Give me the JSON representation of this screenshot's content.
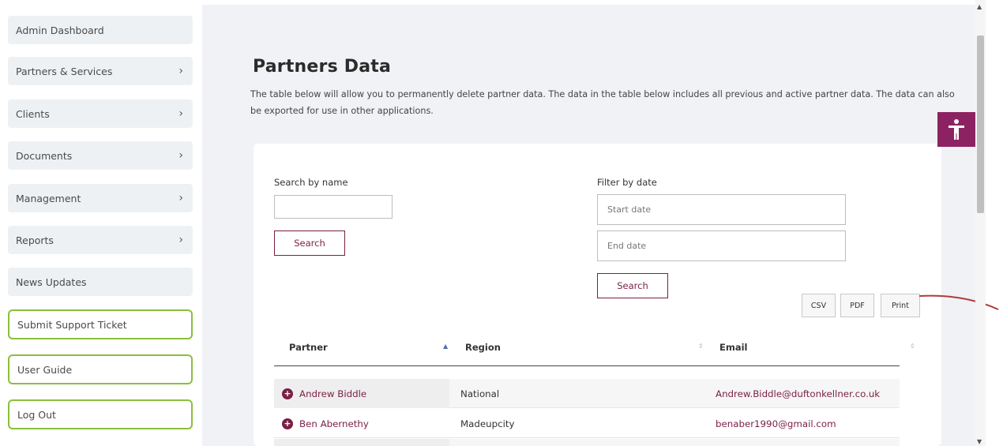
{
  "sidebar": {
    "items": [
      {
        "label": "Admin Dashboard",
        "chevron": ""
      },
      {
        "label": "Partners & Services",
        "chevron": "›"
      },
      {
        "label": "Clients",
        "chevron": "›"
      },
      {
        "label": "Documents",
        "chevron": "›"
      },
      {
        "label": "Management",
        "chevron": "›"
      },
      {
        "label": "Reports",
        "chevron": "›"
      },
      {
        "label": "News Updates",
        "chevron": ""
      },
      {
        "label": "Submit Support Ticket",
        "chevron": ""
      },
      {
        "label": "User Guide",
        "chevron": ""
      },
      {
        "label": "Log Out",
        "chevron": ""
      }
    ]
  },
  "page": {
    "title": "Partners Data",
    "description": "The table below will allow you to permanently delete partner data. The data in the table below includes all previous and active partner data. The data can also be exported for use in other applications."
  },
  "search": {
    "label": "Search by name",
    "value": "",
    "button": "Search"
  },
  "filter": {
    "label": "Filter by date",
    "start_placeholder": "Start date",
    "end_placeholder": "End date",
    "button": "Search"
  },
  "export": {
    "csv": "CSV",
    "pdf": "PDF",
    "print": "Print"
  },
  "table": {
    "columns": [
      "Partner",
      "Region",
      "Email"
    ],
    "rows": [
      {
        "partner": "Andrew Biddle",
        "region": "National",
        "email": "Andrew.Biddle@duftonkellner.co.uk"
      },
      {
        "partner": "Ben Abernethy",
        "region": "Madeupcity",
        "email": "benaber1990@gmail.com"
      }
    ]
  },
  "icons": {
    "accessibility": "accessibility-person-icon",
    "expand": "plus-circle-icon"
  },
  "colors": {
    "accent": "#7a1f45",
    "accessibility_bg": "#8d2262",
    "sidebar_outline": "#8bbf3c",
    "panel_bg": "#f0f2f5"
  }
}
